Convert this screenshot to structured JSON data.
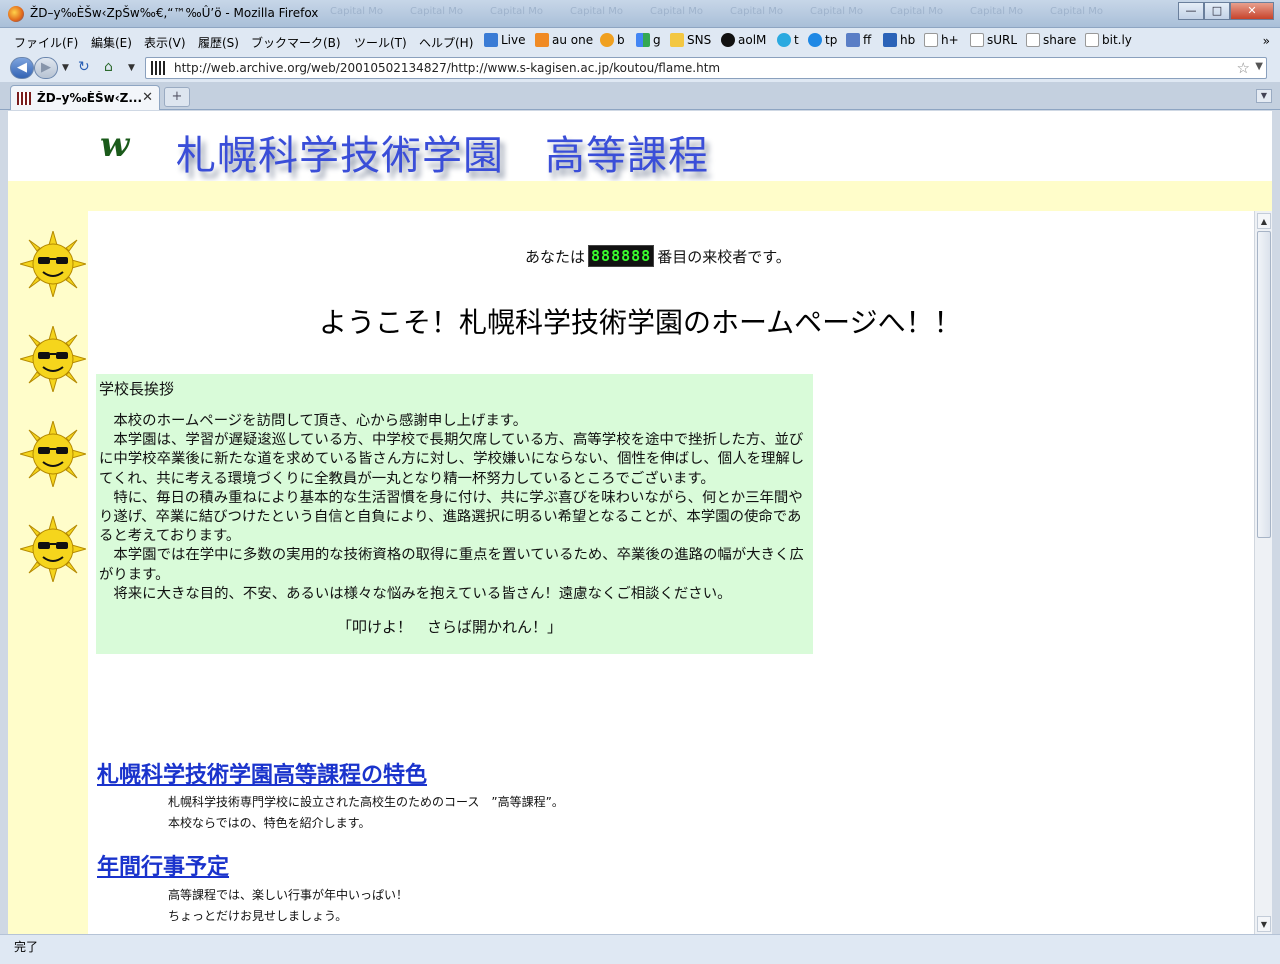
{
  "window": {
    "title": "ŽD–y‰ÈŠw‹ZpŠw‰€,“™‰Û’ö - Mozilla Firefox",
    "ghost_tabs": [
      "Capital Mo",
      "Capital Mo",
      "Capital Mo",
      "Capital Mo",
      "Capital Mo",
      "Capital Mo",
      "Capital Mo",
      "Capital Mo",
      "Capital Mo",
      "Capital Mo"
    ],
    "buttons": {
      "minimize": "—",
      "maximize": "□",
      "close": "✕"
    }
  },
  "menu": {
    "items": [
      "ファイル(F)",
      "編集(E)",
      "表示(V)",
      "履歴(S)",
      "ブックマーク(B)",
      "ツール(T)",
      "ヘルプ(H)"
    ]
  },
  "bookmarks": [
    {
      "label": "Live",
      "color": "#3a7bd5"
    },
    {
      "label": "au one",
      "color": "#f08a24"
    },
    {
      "label": "b",
      "color": "#f0a020"
    },
    {
      "label": "g",
      "color": "#34a853"
    },
    {
      "label": "SNS",
      "color": "#f3c742"
    },
    {
      "label": "aolM",
      "color": "#111111"
    },
    {
      "label": "t",
      "color": "#2aa9e0"
    },
    {
      "label": "tp",
      "color": "#1e88e5"
    },
    {
      "label": "ff",
      "color": "#5a7ec6"
    },
    {
      "label": "hb",
      "color": "#2a62b8"
    },
    {
      "label": "h+",
      "color": "#ffffff"
    },
    {
      "label": "sURL",
      "color": "#ffffff"
    },
    {
      "label": "share",
      "color": "#ffffff"
    },
    {
      "label": "bit.ly",
      "color": "#ffffff"
    }
  ],
  "nav": {
    "back": "◀",
    "forward": "▶",
    "url": "http://web.archive.org/web/20010502134827/http://www.s-kagisen.ac.jp/koutou/flame.htm"
  },
  "tab": {
    "label": "ŽD–y‰ÈŠw‹Z...",
    "close": "✕",
    "new_tab": "+"
  },
  "page": {
    "banner_title": "札幌科学技術学園　高等課程",
    "logo_text": "w",
    "visitor_prefix": "あなたは",
    "counter": "888888",
    "visitor_suffix": "番目の来校者です。",
    "welcome": "ようこそ！札幌科学技術学園のホームページへ！！",
    "greeting": {
      "title": "学校長挨拶",
      "body": "　本校のホームページを訪問して頂き、心から感謝申し上げます。\n　本学園は、学習が遅疑逡巡している方、中学校で長期欠席している方、高等学校を途中で挫折した方、並びに中学校卒業後に新たな道を求めている皆さん方に対し、学校嫌いにならない、個性を伸ばし、個人を理解してくれ、共に考える環境づくりに全教員が一丸となり精一杯努力しているところでございます。\n　特に、毎日の積み重ねにより基本的な生活習慣を身に付け、共に学ぶ喜びを味わいながら、何とか三年間やり遂げ、卒業に結びつけたという自信と自負により、進路選択に明るい希望となることが、本学園の使命であると考えております。\n　本学園では在学中に多数の実用的な技術資格の取得に重点を置いているため、卒業後の進路の幅が大きく広がります。\n　将来に大きな目的、不安、あるいは様々な悩みを抱えている皆さん！遠慮なくご相談ください。",
      "slogan": "「叩けよ！　さらば開かれん！」"
    },
    "sections": [
      {
        "link": "札幌科学技術学園高等課程の特色",
        "desc": [
          "札幌科学技術専門学校に設立された高校生のためのコース　”高等課程”。",
          "本校ならではの、特色を紹介します。"
        ]
      },
      {
        "link": "年間行事予定",
        "desc": [
          "高等課程では、楽しい行事が年中いっぱい！",
          "ちょっとだけお見せしましょう。"
        ]
      }
    ]
  },
  "status": "完了"
}
